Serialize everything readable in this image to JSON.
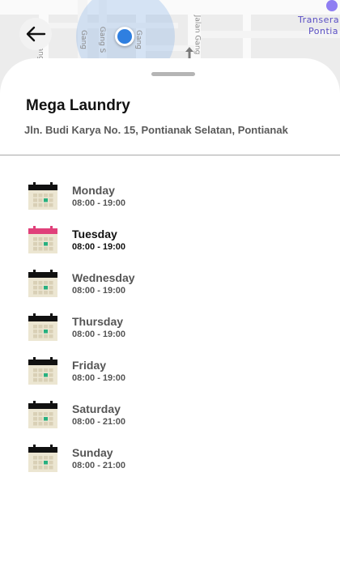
{
  "map": {
    "streets": [
      "Gang S",
      "Gang",
      "Gang S",
      "Jalan Gang",
      "Gang"
    ],
    "poi": [
      "Transera",
      "Pontia"
    ]
  },
  "header": {
    "back_icon": "arrow-left-icon"
  },
  "store": {
    "name": "Mega Laundry",
    "address": "Jln. Budi Karya No. 15, Pontianak Selatan, Pontianak"
  },
  "schedule": [
    {
      "day": "Monday",
      "hours": "08:00 - 19:00",
      "active": false
    },
    {
      "day": "Tuesday",
      "hours": "08:00 - 19:00",
      "active": true
    },
    {
      "day": "Wednesday",
      "hours": "08:00 - 19:00",
      "active": false
    },
    {
      "day": "Thursday",
      "hours": "08:00 - 19:00",
      "active": false
    },
    {
      "day": "Friday",
      "hours": "08:00 - 19:00",
      "active": false
    },
    {
      "day": "Saturday",
      "hours": "08:00 - 21:00",
      "active": false
    },
    {
      "day": "Sunday",
      "hours": "08:00 - 21:00",
      "active": false
    }
  ],
  "colors": {
    "calendar_header": "#111111",
    "calendar_header_active": "#e0407a",
    "calendar_body": "#ece6d2",
    "calendar_today_cell": "#27b07f",
    "location_dot": "#2f7fe0"
  }
}
